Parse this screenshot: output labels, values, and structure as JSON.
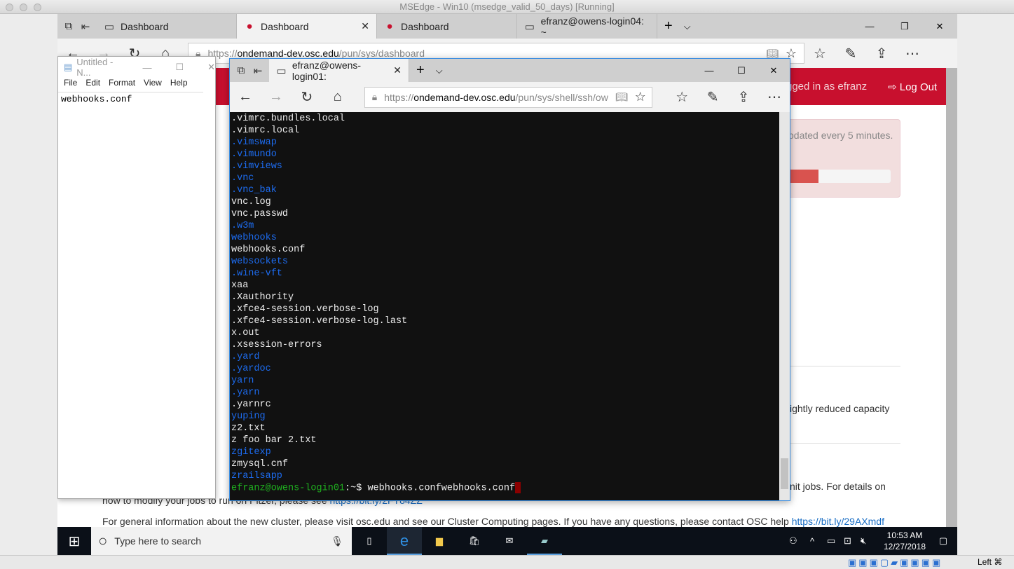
{
  "host": {
    "title": "MSEdge - Win10 (msedge_valid_50_days) [Running]",
    "status_right": "Left ⌘"
  },
  "back_browser": {
    "tabs": [
      {
        "label": "Dashboard"
      },
      {
        "label": "Dashboard",
        "active": true
      },
      {
        "label": "Dashboard"
      },
      {
        "label": "efranz@owens-login04: ~"
      }
    ],
    "url_prefix": "https://",
    "url_host": "ondemand-dev.osc.edu",
    "url_path": "/pun/sys/dashboard",
    "header": {
      "logged_in": "gged in as efranz",
      "logout": "Log Out",
      "color": "#c8102e"
    },
    "alert": {
      "text": "pdated every 5 minutes.",
      "progress_percent": 20
    },
    "texts": [
      "ightly reduced capacity",
      "nit jobs. For details on"
    ],
    "pitzer_line": {
      "text": "how to modify your jobs to run on Pitzer, please see ",
      "link": "https://bit.ly/2FT84ZZ"
    },
    "general_line": {
      "text": "For general information about the new cluster, please visit osc.edu and see our Cluster Computing pages. If you have any questions, please contact OSC help ",
      "link": "https://bit.ly/29AXmdf"
    }
  },
  "notepad": {
    "title": "Untitled - N...",
    "menu": [
      "File",
      "Edit",
      "Format",
      "View",
      "Help"
    ],
    "content": "webhooks.conf"
  },
  "terminal_browser": {
    "tab": "efranz@owens-login01:",
    "url_prefix": "https://",
    "url_host": "ondemand-dev.osc.edu",
    "url_path": "/pun/sys/shell/ssh/ow",
    "lines": [
      {
        "t": ".vimrc.bundles.local",
        "c": ""
      },
      {
        "t": ".vimrc.local",
        "c": ""
      },
      {
        "t": ".vimswap",
        "c": "blue"
      },
      {
        "t": ".vimundo",
        "c": "blue"
      },
      {
        "t": ".vimviews",
        "c": "blue"
      },
      {
        "t": ".vnc",
        "c": "blue"
      },
      {
        "t": ".vnc_bak",
        "c": "blue"
      },
      {
        "t": "vnc.log",
        "c": ""
      },
      {
        "t": "vnc.passwd",
        "c": ""
      },
      {
        "t": ".w3m",
        "c": "blue"
      },
      {
        "t": "webhooks",
        "c": "blue"
      },
      {
        "t": "webhooks.conf",
        "c": ""
      },
      {
        "t": "websockets",
        "c": "blue"
      },
      {
        "t": ".wine-vft",
        "c": "blue"
      },
      {
        "t": "xaa",
        "c": ""
      },
      {
        "t": ".Xauthority",
        "c": ""
      },
      {
        "t": ".xfce4-session.verbose-log",
        "c": ""
      },
      {
        "t": ".xfce4-session.verbose-log.last",
        "c": ""
      },
      {
        "t": "x.out",
        "c": ""
      },
      {
        "t": ".xsession-errors",
        "c": ""
      },
      {
        "t": ".yard",
        "c": "blue"
      },
      {
        "t": ".yardoc",
        "c": "blue"
      },
      {
        "t": "yarn",
        "c": "blue"
      },
      {
        "t": ".yarn",
        "c": "blue"
      },
      {
        "t": ".yarnrc",
        "c": ""
      },
      {
        "t": "yuping",
        "c": "blue"
      },
      {
        "t": "z2.txt",
        "c": ""
      },
      {
        "t": "z foo bar 2.txt",
        "c": ""
      },
      {
        "t": "zgitexp",
        "c": "blue"
      },
      {
        "t": "zmysql.cnf",
        "c": ""
      },
      {
        "t": "zrailsapp",
        "c": "blue"
      }
    ],
    "prompt": "efranz@owens-login01",
    "prompt_suffix": ":~$ ",
    "command": "webhooks.confwebhooks.conf"
  },
  "taskbar": {
    "search_placeholder": "Type here to search",
    "time": "10:53 AM",
    "date": "12/27/2018"
  }
}
